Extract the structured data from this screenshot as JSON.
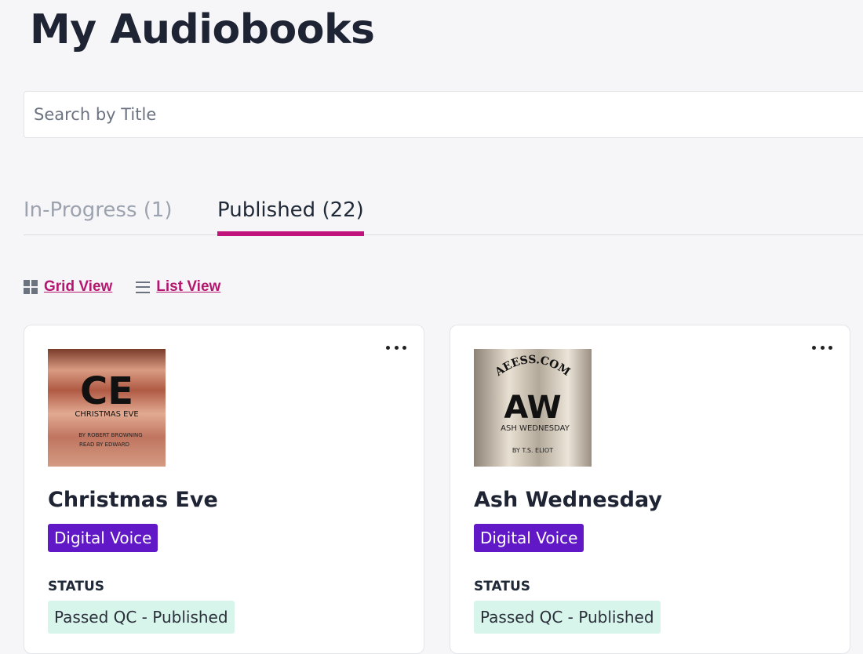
{
  "page": {
    "title": "My Audiobooks"
  },
  "search": {
    "placeholder": "Search by Title",
    "value": ""
  },
  "tabs": [
    {
      "label": "In-Progress (1)",
      "active": false
    },
    {
      "label": "Published (22)",
      "active": true
    }
  ],
  "views": {
    "grid_label": "Grid View",
    "list_label": "List View"
  },
  "books": [
    {
      "title": "Christmas Eve",
      "voice": "Digital Voice",
      "status_label": "STATUS",
      "status": "Passed QC - Published",
      "cover": {
        "initials": "CE",
        "subtitle": "CHRISTMAS EVE",
        "line1": "BY ROBERT BROWNING",
        "line2": "READ BY EDWARD"
      }
    },
    {
      "title": "Ash Wednesday",
      "voice": "Digital Voice",
      "status_label": "STATUS",
      "status": "Passed QC - Published",
      "cover": {
        "arc": "AEESS.COM",
        "initials": "AW",
        "subtitle": "ASH WEDNESDAY",
        "line1": "BY T.S. ELIOT"
      }
    }
  ],
  "colors": {
    "accent": "#c0137b",
    "link": "#b5166f",
    "voice_badge": "#6118c7",
    "status_badge": "#d8f5ec"
  },
  "icons": {
    "grid": "grid-icon",
    "list": "list-icon",
    "more": "more-options-icon"
  }
}
